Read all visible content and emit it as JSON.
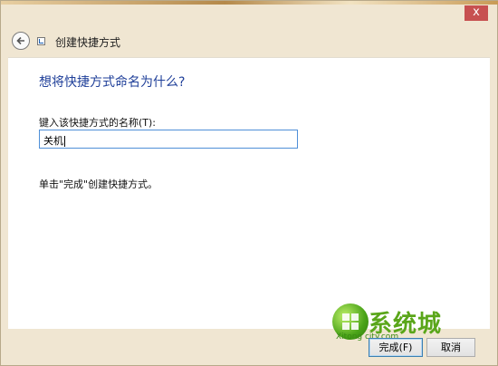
{
  "window": {
    "close_glyph": "x"
  },
  "nav": {
    "title": "创建快捷方式"
  },
  "main": {
    "heading": "想将快捷方式命名为什么?",
    "field_label": "键入该快捷方式的名称(T):",
    "field_value": "关机",
    "hint": "单击\"完成\"创建快捷方式。"
  },
  "footer": {
    "finish_label": "完成(F)",
    "cancel_label": "取消"
  },
  "watermark": {
    "brand": "系统城",
    "url": "Xitong city.com"
  },
  "colors": {
    "heading": "#1f3f99",
    "close_button": "#c75050",
    "input_border": "#4f8fd8"
  }
}
